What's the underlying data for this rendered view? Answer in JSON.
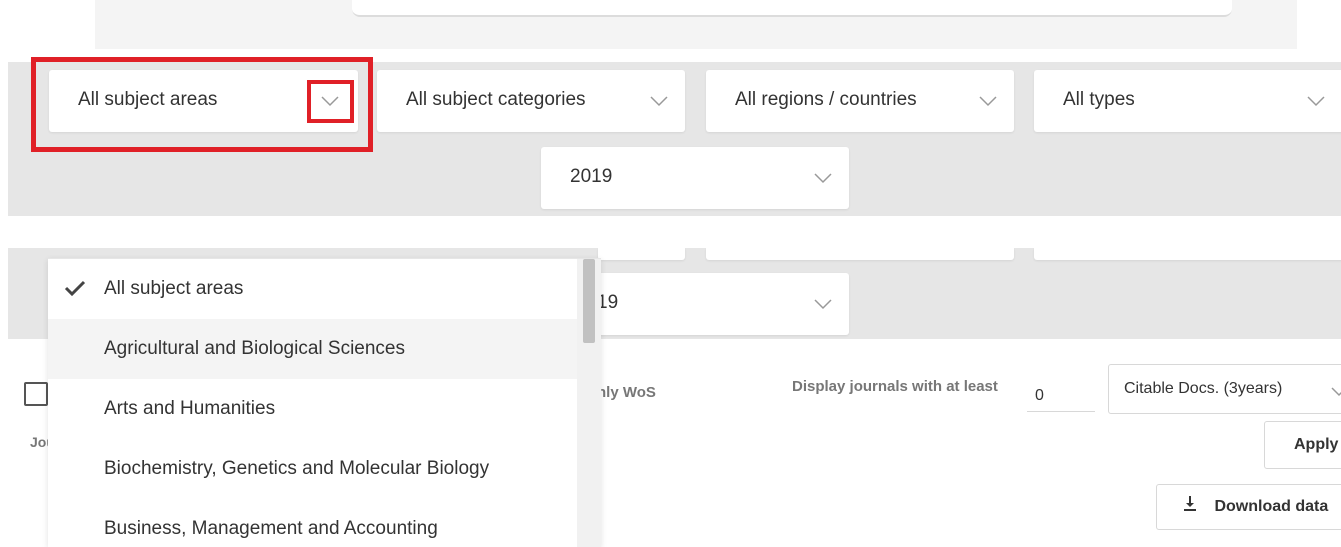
{
  "filters": {
    "subject_area": "All subject areas",
    "subject_category": "All subject categories",
    "region": "All regions / countries",
    "type": "All types",
    "year": "2019",
    "year_partial": "19"
  },
  "dropdown_menu": {
    "items": [
      {
        "label": "All subject areas",
        "selected": true
      },
      {
        "label": "Agricultural and Biological Sciences",
        "selected": false
      },
      {
        "label": "Arts and Humanities",
        "selected": false
      },
      {
        "label": "Biochemistry, Genetics and Molecular Biology",
        "selected": false
      },
      {
        "label": "Business, Management and Accounting",
        "selected": false
      }
    ]
  },
  "options": {
    "journals_label_partial": "Jou",
    "wos_label_partial": "nly WoS",
    "min_label": "Display journals with at least",
    "min_value": "0",
    "citable_select": "Citable Docs. (3years)",
    "apply_label": "Apply",
    "download_label": "Download data"
  },
  "colors": {
    "highlight": "#e02027",
    "band": "#e6e6e6",
    "chevron": "#999999"
  },
  "icons": {
    "chevron": "chevron-down-icon",
    "check": "check-icon",
    "download": "download-icon"
  }
}
